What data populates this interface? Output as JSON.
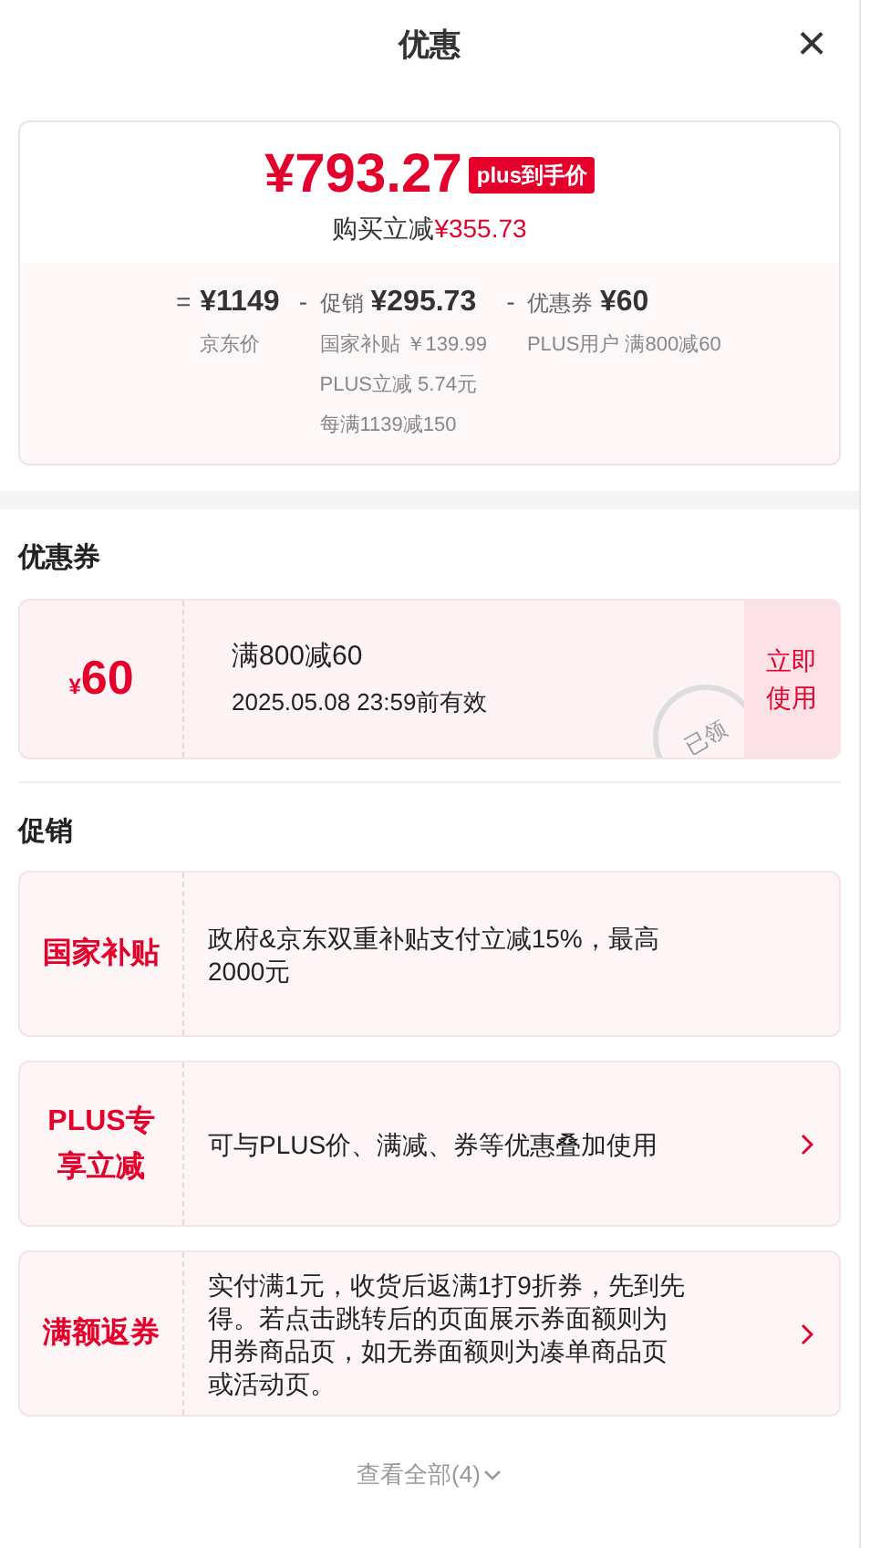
{
  "header": {
    "title": "优惠",
    "close": "×"
  },
  "summary": {
    "price": "¥793.27",
    "price_badge": "plus到手价",
    "saving_label": "购买立减",
    "saving_amount": "¥355.73",
    "breakdown": [
      {
        "operator": "=",
        "amount": "¥1149",
        "notes": [
          "京东价"
        ]
      },
      {
        "operator": "-",
        "label": "促销",
        "amount": "¥295.73",
        "notes": [
          "国家补贴 ￥139.99",
          "PLUS立减 5.74元",
          "每满1139减150"
        ]
      },
      {
        "operator": "-",
        "label": "优惠券",
        "amount": "¥60",
        "notes": [
          "PLUS用户 满800减60"
        ]
      }
    ]
  },
  "coupons": {
    "title": "优惠券",
    "items": [
      {
        "currency": "¥",
        "amount": "60",
        "condition": "满800减60",
        "validity": "2025.05.08 23:59前有效",
        "claimed": true,
        "stamp": "已领",
        "action": "立即使用"
      }
    ]
  },
  "promotions": {
    "title": "促销",
    "items": [
      {
        "tag": "国家补贴",
        "text": "政府&京东双重补贴支付立减15%，最高2000元",
        "arrow": false
      },
      {
        "tag": "PLUS专享立减",
        "text": "可与PLUS价、满减、券等优惠叠加使用",
        "arrow": true
      },
      {
        "tag": "满额返券",
        "text": "实付满1元，收货后返满1打9折券，先到先得。若点击跳转后的页面展示券面额则为用券商品页，如无券面额则为凑单商品页或活动页。",
        "arrow": true
      }
    ],
    "view_all": "查看全部(4)"
  }
}
